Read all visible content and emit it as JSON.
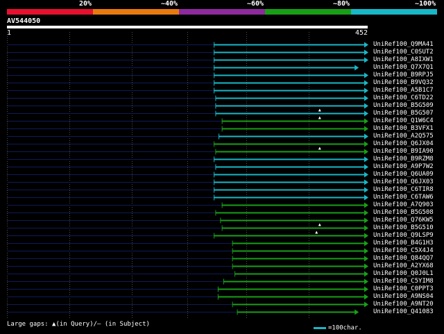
{
  "legend": {
    "labels": [
      "20%",
      "~40%",
      "~60%",
      "~80%",
      "~100%"
    ],
    "colors": [
      "#e8102f",
      "#e87a10",
      "#8e2a9e",
      "#17a017",
      "#17b8c8"
    ]
  },
  "query": {
    "name": "AV544050",
    "start": "1",
    "end": "452",
    "length": 452
  },
  "hits": [
    {
      "name": "UniRef100_Q9MA41",
      "start": 260,
      "end": 452,
      "color": "#17b8c8",
      "arrow": "right",
      "gaps": []
    },
    {
      "name": "UniRef100_C0SUT2",
      "start": 260,
      "end": 452,
      "color": "#17b8c8",
      "arrow": "right",
      "gaps": []
    },
    {
      "name": "UniRef100_A8IXW1",
      "start": 260,
      "end": 452,
      "color": "#17b8c8",
      "arrow": "right",
      "gaps": []
    },
    {
      "name": "UniRef100_Q7X7Q1",
      "start": 260,
      "end": 440,
      "color": "#17b8c8",
      "arrow": "right",
      "gaps": []
    },
    {
      "name": "UniRef100_B9RPJ5",
      "start": 260,
      "end": 452,
      "color": "#17b8c8",
      "arrow": "right",
      "gaps": []
    },
    {
      "name": "UniRef100_B9VQ32",
      "start": 260,
      "end": 452,
      "color": "#17b8c8",
      "arrow": "right",
      "gaps": []
    },
    {
      "name": "UniRef100_A5B1C7",
      "start": 260,
      "end": 452,
      "color": "#17b8c8",
      "arrow": "right",
      "gaps": []
    },
    {
      "name": "UniRef100_C6TD22",
      "start": 262,
      "end": 452,
      "color": "#17b8c8",
      "arrow": "right",
      "gaps": []
    },
    {
      "name": "UniRef100_B5G509",
      "start": 262,
      "end": 452,
      "color": "#17b8c8",
      "arrow": "right",
      "gaps": []
    },
    {
      "name": "UniRef100_B5G507",
      "start": 262,
      "end": 452,
      "color": "#17b8c8",
      "arrow": "right",
      "gaps": [
        392
      ]
    },
    {
      "name": "UniRef100_Q1W6C4",
      "start": 270,
      "end": 452,
      "color": "#17a017",
      "arrow": "right",
      "gaps": [
        392
      ]
    },
    {
      "name": "UniRef100_B3VFX1",
      "start": 270,
      "end": 452,
      "color": "#17a017",
      "arrow": "right",
      "gaps": []
    },
    {
      "name": "UniRef100_A2Q575",
      "start": 266,
      "end": 452,
      "color": "#17b8c8",
      "arrow": "right",
      "gaps": []
    },
    {
      "name": "UniRef100_Q6JX04",
      "start": 260,
      "end": 452,
      "color": "#17a017",
      "arrow": "right",
      "gaps": []
    },
    {
      "name": "UniRef100_B9IA90",
      "start": 262,
      "end": 452,
      "color": "#17a017",
      "arrow": "right",
      "gaps": [
        392
      ]
    },
    {
      "name": "UniRef100_B9RZM8",
      "start": 260,
      "end": 452,
      "color": "#17b8c8",
      "arrow": "right",
      "gaps": []
    },
    {
      "name": "UniRef100_A9P7W2",
      "start": 262,
      "end": 452,
      "color": "#17b8c8",
      "arrow": "right",
      "gaps": []
    },
    {
      "name": "UniRef100_Q6UA09",
      "start": 260,
      "end": 452,
      "color": "#17b8c8",
      "arrow": "right",
      "gaps": []
    },
    {
      "name": "UniRef100_Q6JX03",
      "start": 260,
      "end": 452,
      "color": "#17b8c8",
      "arrow": "right",
      "gaps": []
    },
    {
      "name": "UniRef100_C6TIR8",
      "start": 260,
      "end": 452,
      "color": "#17b8c8",
      "arrow": "right",
      "gaps": []
    },
    {
      "name": "UniRef100_C6TAW6",
      "start": 260,
      "end": 452,
      "color": "#17b8c8",
      "arrow": "right",
      "gaps": []
    },
    {
      "name": "UniRef100_A7Q903",
      "start": 270,
      "end": 452,
      "color": "#17a017",
      "arrow": "right",
      "gaps": []
    },
    {
      "name": "UniRef100_B5G508",
      "start": 262,
      "end": 452,
      "color": "#17a017",
      "arrow": "right",
      "gaps": []
    },
    {
      "name": "UniRef100_Q76KW5",
      "start": 268,
      "end": 452,
      "color": "#17a017",
      "arrow": "right",
      "gaps": []
    },
    {
      "name": "UniRef100_B5G510",
      "start": 270,
      "end": 452,
      "color": "#17a017",
      "arrow": "right",
      "gaps": [
        392
      ]
    },
    {
      "name": "UniRef100_Q9LSP9",
      "start": 260,
      "end": 452,
      "color": "#17a017",
      "arrow": "right",
      "gaps": [
        388
      ]
    },
    {
      "name": "UniRef100_B4G1H3",
      "start": 283,
      "end": 452,
      "color": "#17a017",
      "arrow": "right",
      "gaps": []
    },
    {
      "name": "UniRef100_C5X4J4",
      "start": 283,
      "end": 452,
      "color": "#17a017",
      "arrow": "right",
      "gaps": []
    },
    {
      "name": "UniRef100_Q84QQ7",
      "start": 283,
      "end": 452,
      "color": "#17a017",
      "arrow": "right",
      "gaps": []
    },
    {
      "name": "UniRef100_A2YX68",
      "start": 283,
      "end": 452,
      "color": "#17a017",
      "arrow": "right",
      "gaps": []
    },
    {
      "name": "UniRef100_Q0J0L1",
      "start": 286,
      "end": 452,
      "color": "#17a017",
      "arrow": "right",
      "gaps": []
    },
    {
      "name": "UniRef100_C5YIM8",
      "start": 272,
      "end": 452,
      "color": "#17a017",
      "arrow": "right",
      "gaps": []
    },
    {
      "name": "UniRef100_C0PPT3",
      "start": 265,
      "end": 452,
      "color": "#17a017",
      "arrow": "right",
      "gaps": []
    },
    {
      "name": "UniRef100_A9NS04",
      "start": 265,
      "end": 452,
      "color": "#17a017",
      "arrow": "right",
      "gaps": []
    },
    {
      "name": "UniRef100_A9NT20",
      "start": 283,
      "end": 452,
      "color": "#17a017",
      "arrow": "right",
      "gaps": []
    },
    {
      "name": "UniRef100_Q41083",
      "start": 289,
      "end": 440,
      "color": "#17a017",
      "arrow": "right",
      "gaps": []
    }
  ],
  "footer": {
    "note": "Large gaps: ▲(in Query)/– (in Subject)",
    "scale_label": "=100char."
  },
  "colors": {
    "background": "#000000",
    "unaligned_line": "#101a5a",
    "gridline": "#505050",
    "text": "#ffffff"
  }
}
